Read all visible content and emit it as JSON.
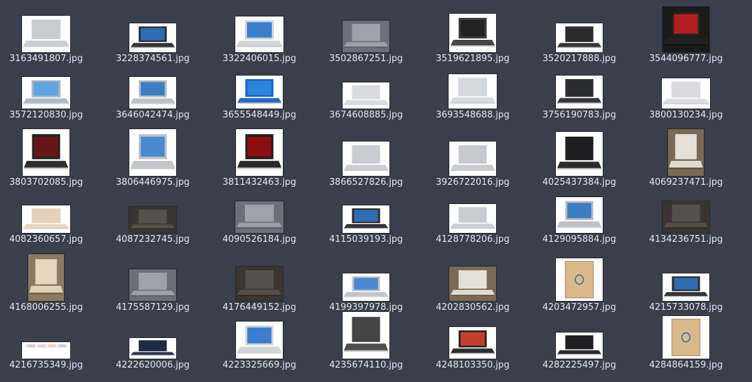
{
  "files": [
    {
      "name": "3163491807.jpg",
      "icon": "laptop-silver-thumbnail-icon"
    },
    {
      "name": "3228374561.jpg",
      "icon": "laptop-black-windows-thumbnail-icon"
    },
    {
      "name": "3322406015.jpg",
      "icon": "laptop-hp-product-thumbnail-icon"
    },
    {
      "name": "3502867251.jpg",
      "icon": "laptop-photo-thumbnail-icon"
    },
    {
      "name": "3519621895.jpg",
      "icon": "laptop-elitebook-thumbnail-icon"
    },
    {
      "name": "3520217888.jpg",
      "icon": "laptop-zbook-thumbnail-icon"
    },
    {
      "name": "3544096777.jpg",
      "icon": "laptop-gaming-red-thumbnail-icon"
    },
    {
      "name": "3572120830.jpg",
      "icon": "laptop-blue-screen-thumbnail-icon"
    },
    {
      "name": "3646042474.jpg",
      "icon": "laptop-silver-windows-thumbnail-icon"
    },
    {
      "name": "3655548449.jpg",
      "icon": "surface-blue-thumbnail-icon"
    },
    {
      "name": "3674608885.jpg",
      "icon": "laptop-slim-side-thumbnail-icon"
    },
    {
      "name": "3693548688.jpg",
      "icon": "laptop-silver-open-thumbnail-icon"
    },
    {
      "name": "3756190783.jpg",
      "icon": "laptop-dark-angle-thumbnail-icon"
    },
    {
      "name": "3800130234.jpg",
      "icon": "laptop-convertible-thumbnail-icon"
    },
    {
      "name": "3803702085.jpg",
      "icon": "laptop-gaming-black-thumbnail-icon"
    },
    {
      "name": "3806446975.jpg",
      "icon": "laptop-detachable-thumbnail-icon"
    },
    {
      "name": "3811432463.jpg",
      "icon": "laptop-msi-thumbnail-icon"
    },
    {
      "name": "3866527826.jpg",
      "icon": "laptop-silver-thumbnail-icon"
    },
    {
      "name": "3926722016.jpg",
      "icon": "laptop-flip-thumbnail-icon"
    },
    {
      "name": "4025437384.jpg",
      "icon": "laptop-black-thumbnail-icon"
    },
    {
      "name": "4069237471.jpg",
      "icon": "laptop-box-photo-thumbnail-icon"
    },
    {
      "name": "4082360657.jpg",
      "icon": "laptop-gold-thumbnail-icon"
    },
    {
      "name": "4087232745.jpg",
      "icon": "laptop-photo-dark-thumbnail-icon"
    },
    {
      "name": "4090526184.jpg",
      "icon": "laptop-photo-thumbnail-icon"
    },
    {
      "name": "4115039193.jpg",
      "icon": "laptop-black-windows-thumbnail-icon"
    },
    {
      "name": "4128778206.jpg",
      "icon": "laptop-silver-thumbnail-icon"
    },
    {
      "name": "4129095884.jpg",
      "icon": "laptop-silver-windows-thumbnail-icon"
    },
    {
      "name": "4134236751.jpg",
      "icon": "laptop-photo-dark-thumbnail-icon"
    },
    {
      "name": "4168006255.jpg",
      "icon": "laptop-gold-box-thumbnail-icon"
    },
    {
      "name": "4175587129.jpg",
      "icon": "laptop-photo-thumbnail-icon"
    },
    {
      "name": "4176449152.jpg",
      "icon": "laptop-photo-dark-thumbnail-icon"
    },
    {
      "name": "4199397978.jpg",
      "icon": "laptop-detachable-thumbnail-icon"
    },
    {
      "name": "4202830562.jpg",
      "icon": "laptop-box-photo-thumbnail-icon"
    },
    {
      "name": "4203472957.jpg",
      "icon": "laptop-box-thumbnail-icon"
    },
    {
      "name": "4215733078.jpg",
      "icon": "laptop-black-windows-thumbnail-icon"
    },
    {
      "name": "4216735349.jpg",
      "icon": "laptop-colors-thumbnail-icon"
    },
    {
      "name": "4222620006.jpg",
      "icon": "laptop-blue-thumbnail-icon"
    },
    {
      "name": "4223325669.jpg",
      "icon": "laptop-hp-product-thumbnail-icon"
    },
    {
      "name": "4235674110.jpg",
      "icon": "laptop-elitebook-angle-thumbnail-icon"
    },
    {
      "name": "4248103350.jpg",
      "icon": "laptop-black-red-screen-thumbnail-icon"
    },
    {
      "name": "4282225497.jpg",
      "icon": "laptop-black-thumbnail-icon"
    },
    {
      "name": "4284864159.jpg",
      "icon": "laptop-box-thumbnail-icon"
    }
  ]
}
